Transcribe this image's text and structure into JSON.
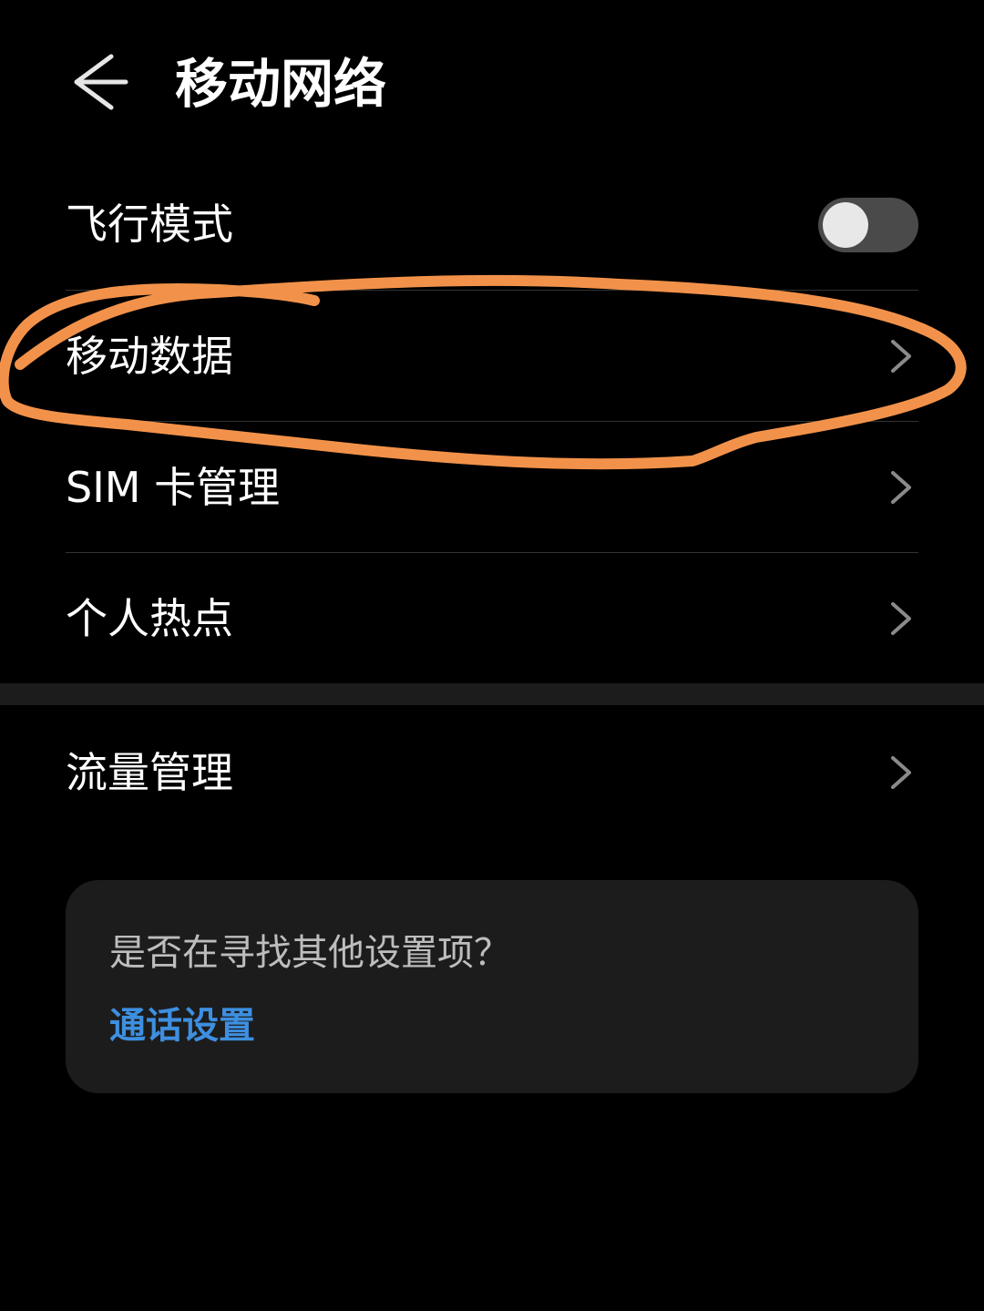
{
  "header": {
    "title": "移动网络",
    "back_icon": "arrow-left-icon"
  },
  "rows": {
    "airplane_mode": {
      "label": "飞行模式",
      "toggle_on": false
    },
    "mobile_data": {
      "label": "移动数据"
    },
    "sim_management": {
      "label": "SIM 卡管理"
    },
    "personal_hotspot": {
      "label": "个人热点"
    },
    "data_usage": {
      "label": "流量管理"
    }
  },
  "suggestion": {
    "question": "是否在寻找其他设置项？",
    "link_label": "通话设置"
  },
  "colors": {
    "background": "#000000",
    "text": "#ffffff",
    "link": "#3e8fe0",
    "annotation": "#f2924a",
    "card": "#1c1c1c"
  }
}
